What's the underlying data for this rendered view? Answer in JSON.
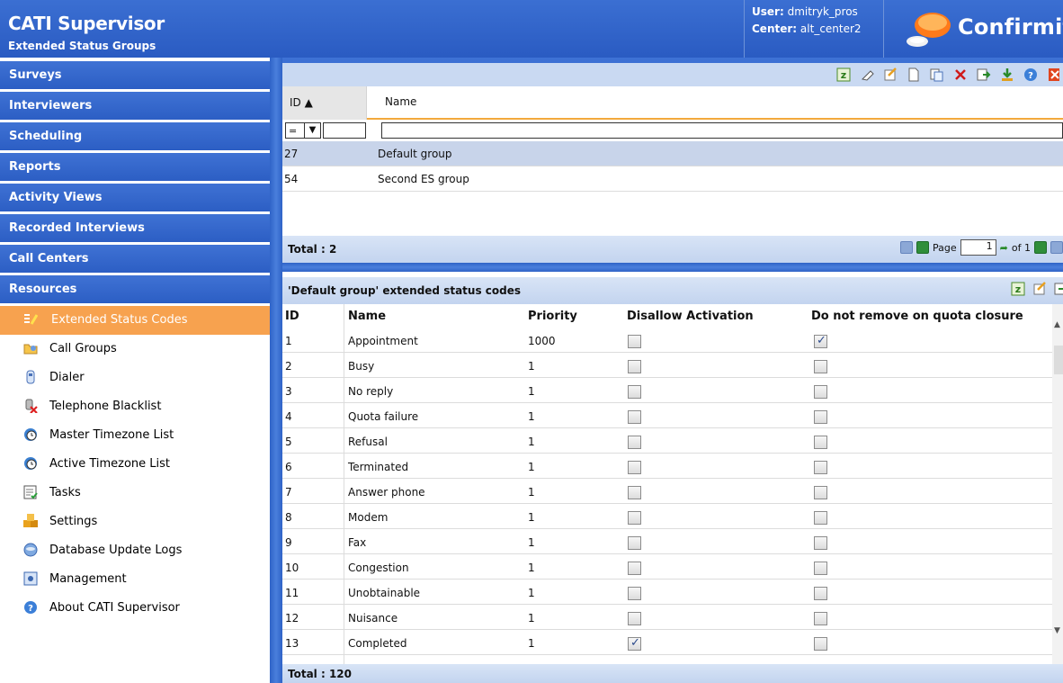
{
  "header": {
    "title": "CATI Supervisor",
    "subtitle": "Extended Status Groups",
    "user_label": "User:",
    "user_value": "dmitryk_pros",
    "center_label": "Center:",
    "center_value": "alt_center2",
    "brand": "Confirmit"
  },
  "sidebar": {
    "nav": [
      "Surveys",
      "Interviewers",
      "Scheduling",
      "Reports",
      "Activity Views",
      "Recorded Interviews",
      "Call Centers",
      "Resources"
    ],
    "resources_items": [
      {
        "label": "Extended Status Codes",
        "icon": "status-codes-icon",
        "active": true
      },
      {
        "label": "Call Groups",
        "icon": "call-groups-icon"
      },
      {
        "label": "Dialer",
        "icon": "dialer-icon"
      },
      {
        "label": "Telephone Blacklist",
        "icon": "telephone-blacklist-icon"
      },
      {
        "label": "Master Timezone List",
        "icon": "timezone-icon"
      },
      {
        "label": "Active Timezone List",
        "icon": "timezone-icon"
      },
      {
        "label": "Tasks",
        "icon": "tasks-icon"
      },
      {
        "label": "Settings",
        "icon": "settings-icon"
      },
      {
        "label": "Database Update Logs",
        "icon": "database-icon"
      },
      {
        "label": "Management",
        "icon": "management-icon"
      },
      {
        "label": "About CATI Supervisor",
        "icon": "help-icon"
      }
    ]
  },
  "groups_grid": {
    "col_id": "ID ▲",
    "col_name": "Name",
    "filter_op": "=",
    "rows": [
      {
        "id": "27",
        "name": "Default group",
        "selected": true
      },
      {
        "id": "54",
        "name": "Second ES group",
        "selected": false
      }
    ],
    "total": "Total : 2",
    "page_label": "Page",
    "page_value": "1",
    "of_label": "of 1"
  },
  "codes_grid": {
    "title": "'Default group' extended status codes",
    "columns": [
      "ID",
      "Name",
      "Priority",
      "Disallow Activation",
      "Do not remove on quota closure"
    ],
    "rows": [
      {
        "id": "1",
        "name": "Appointment",
        "priority": "1000",
        "disallow": false,
        "noremove": true
      },
      {
        "id": "2",
        "name": "Busy",
        "priority": "1",
        "disallow": false,
        "noremove": false
      },
      {
        "id": "3",
        "name": "No reply",
        "priority": "1",
        "disallow": false,
        "noremove": false
      },
      {
        "id": "4",
        "name": "Quota failure",
        "priority": "1",
        "disallow": false,
        "noremove": false
      },
      {
        "id": "5",
        "name": "Refusal",
        "priority": "1",
        "disallow": false,
        "noremove": false
      },
      {
        "id": "6",
        "name": "Terminated",
        "priority": "1",
        "disallow": false,
        "noremove": false
      },
      {
        "id": "7",
        "name": "Answer phone",
        "priority": "1",
        "disallow": false,
        "noremove": false
      },
      {
        "id": "8",
        "name": "Modem",
        "priority": "1",
        "disallow": false,
        "noremove": false
      },
      {
        "id": "9",
        "name": "Fax",
        "priority": "1",
        "disallow": false,
        "noremove": false
      },
      {
        "id": "10",
        "name": "Congestion",
        "priority": "1",
        "disallow": false,
        "noremove": false
      },
      {
        "id": "11",
        "name": "Unobtainable",
        "priority": "1",
        "disallow": false,
        "noremove": false
      },
      {
        "id": "12",
        "name": "Nuisance",
        "priority": "1",
        "disallow": false,
        "noremove": false
      },
      {
        "id": "13",
        "name": "Completed",
        "priority": "1",
        "disallow": true,
        "noremove": false
      }
    ],
    "total": "Total : 120"
  },
  "colors": {
    "header_blue": "#2a5bc2",
    "active_orange": "#f7a24f",
    "selected_row": "#c8d4ea",
    "grid_accent": "#f3a93d"
  }
}
